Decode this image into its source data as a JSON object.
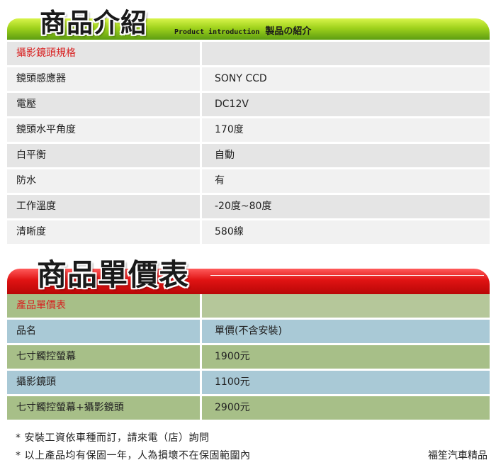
{
  "intro_banner": {
    "title": "商品介紹",
    "subtitle_en": "Product introduction",
    "subtitle_zh": "製品の紹介"
  },
  "spec_table": {
    "header": "攝影鏡頭規格",
    "rows": [
      {
        "label": "鏡頭感應器",
        "value": "SONY CCD"
      },
      {
        "label": "電壓",
        "value": "DC12V"
      },
      {
        "label": "鏡頭水平角度",
        "value": "170度"
      },
      {
        "label": "白平衡",
        "value": "自動"
      },
      {
        "label": "防水",
        "value": "有"
      },
      {
        "label": "工作溫度",
        "value": "-20度~80度"
      },
      {
        "label": "清晰度",
        "value": "580線"
      }
    ]
  },
  "price_banner": {
    "title": "商品單價表"
  },
  "price_table": {
    "header": "產品單價表",
    "column_labels": {
      "name": "品名",
      "price": "單價(不含安裝)"
    },
    "rows": [
      {
        "name": "七寸觸控螢幕",
        "price": "1900元"
      },
      {
        "name": "攝影鏡頭",
        "price": "1100元"
      },
      {
        "name": "七寸觸控螢幕+攝影鏡頭",
        "price": "2900元"
      }
    ]
  },
  "notes": [
    "* 安裝工資依車種而訂，請來電（店）詢問",
    "* 以上產品均有保固一年，人為損壞不在保固範圍內"
  ],
  "shop_name": "福笙汽車精品",
  "colors": {
    "green_banner": "#9fd21c",
    "red_banner": "#e01313",
    "header_text": "#d81e1e",
    "price_green": "#a7bf88",
    "price_blue": "#a9c9d6"
  }
}
